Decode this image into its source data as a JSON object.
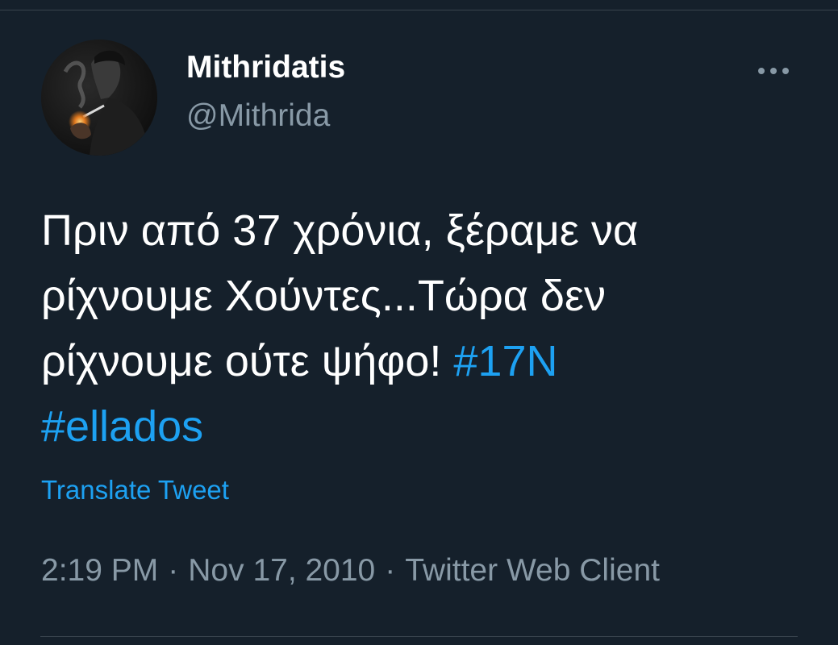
{
  "author": {
    "display_name": "Mithridatis",
    "handle": "@Mithrida"
  },
  "more_button_icon": "more-horizontal-icon",
  "tweet": {
    "text_line_1": "Πριν από 37 χρόνια, ξέραμε να",
    "text_line_2": "ρίχνουμε Χούντες...Τώρα δεν",
    "text_line_3": "ρίχνουμε ούτε ψήφο!",
    "hashtag_1": "#17N",
    "hashtag_2": "#ellados"
  },
  "translate_label": "Translate Tweet",
  "meta": {
    "time": "2:19 PM",
    "separator": "·",
    "date": "Nov 17, 2010",
    "client": "Twitter Web Client"
  },
  "colors": {
    "background": "#15202b",
    "link": "#1da1f2",
    "secondary_text": "#8899a6",
    "divider": "#38444d"
  }
}
